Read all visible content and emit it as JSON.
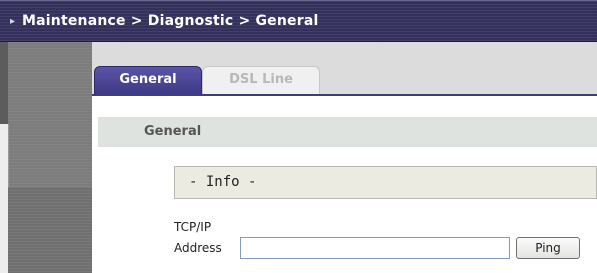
{
  "header": {
    "breadcrumb": "Maintenance > Diagnostic > General"
  },
  "tabs": [
    {
      "label": "General",
      "active": true
    },
    {
      "label": "DSL Line",
      "active": false
    }
  ],
  "section": {
    "title": "General"
  },
  "info": {
    "label": "- Info -"
  },
  "form": {
    "field_label_line1": "TCP/IP",
    "field_label_line2": "Address",
    "ip_value": "",
    "ping_label": "Ping"
  },
  "colors": {
    "titlebar": "#34305c",
    "active_tab": "#3d3a86",
    "section_header": "#dfe3e0",
    "info_box": "#ecebe1"
  }
}
